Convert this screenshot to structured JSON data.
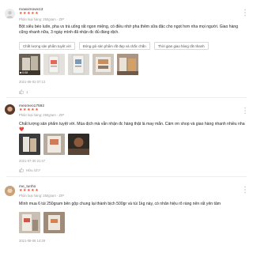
{
  "colors": {
    "star": "#ee4d2d",
    "muted": "#999999",
    "text": "#222222",
    "border": "#d9d9d9"
  },
  "reviews": [
    {
      "username": "mowxmowx13",
      "stars": "★★★★★",
      "variation": "Phân loại hàng: 250gram - ZIP",
      "comment": "Bột siêu béo luôn, pha vs trà uống rất ngon miệng, có điều nhớ pha thêm sữa đặc cho ngọt hơn nha mọi người. Giao hàng cũng nhanh nữa, 3 ngày mình đã nhận đc đủ đàng dịch.",
      "tags": [
        "Chất lượng sản phẩm tuyệt vời",
        "Đóng gói sản phẩm rất đẹp và chắc chắn",
        "Thời gian giao hàng rất nhanh"
      ],
      "video_duration": "0:08",
      "timestamp": "2021-08-02 07:13",
      "likes": "1"
    },
    {
      "username": "meomeo17592",
      "stars": "★★★★★",
      "variation": "Phân loại hàng: 250gram - ZIP",
      "comment": "Chất lượng sản phẩm tuyệt vời. Mùa dịch mà vẫn nhận đc hàng thật là may mắn. Cảm ơn shop và giao hàng nhanh nhiều nha ❤️",
      "timestamp": "2021-07-30 21:47",
      "likes": "Hữu ích?"
    },
    {
      "username": "me_tunho",
      "stars": "★★★★★",
      "variation": "Phân loại hàng: 250gram - ZIP",
      "comment": "Mình mua 6 túi 250gram bên gộp chung lại thành bịch 500gr và túi 1kg này, có nhãn hiệu rõ ràng nên rất yên tâm",
      "timestamp": "2021-08-06 14:29"
    }
  ]
}
